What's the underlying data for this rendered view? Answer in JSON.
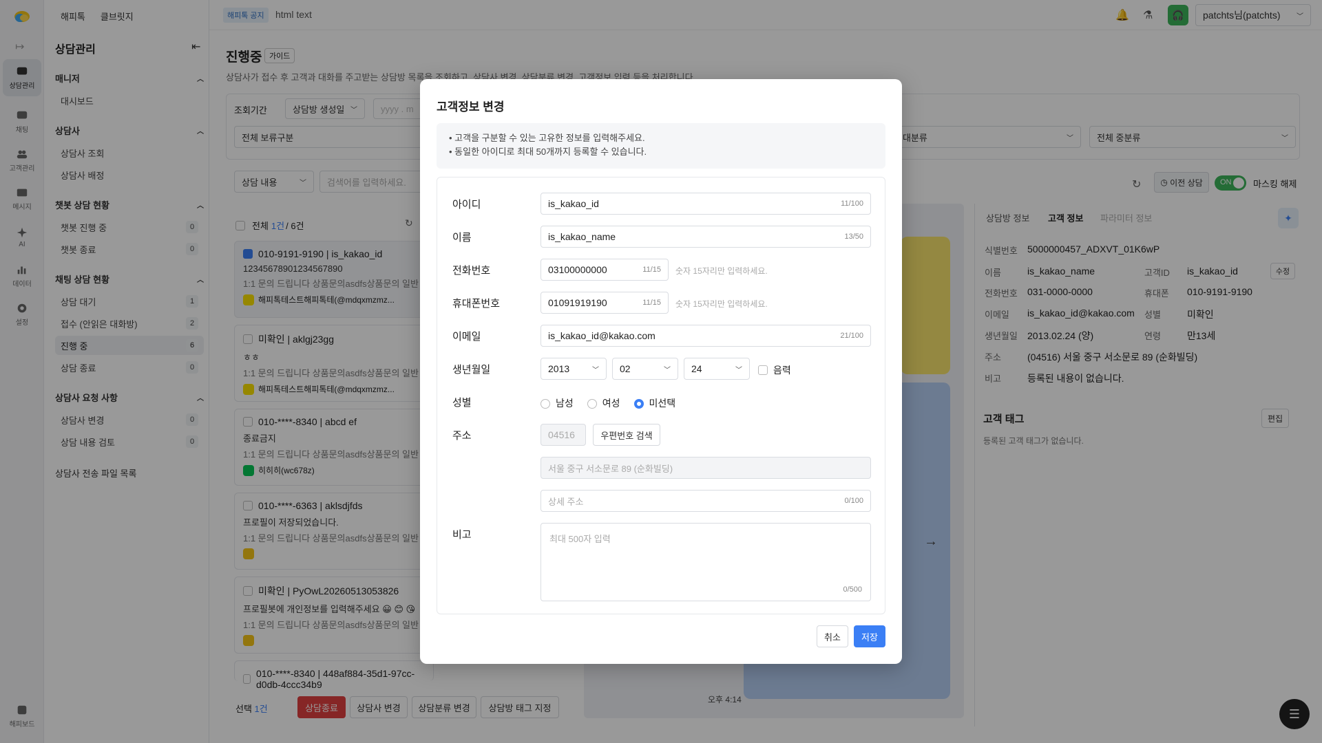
{
  "rail": [
    {
      "label": "상담관리",
      "icon": "chat-bubble-icon"
    },
    {
      "label": "채팅",
      "icon": "message-icon"
    },
    {
      "label": "고객관리",
      "icon": "users-icon"
    },
    {
      "label": "메시지",
      "icon": "mail-icon"
    },
    {
      "label": "AI",
      "icon": "sparkle-icon"
    },
    {
      "label": "데이터",
      "icon": "bar-chart-icon"
    },
    {
      "label": "설정",
      "icon": "gear-icon"
    },
    {
      "label": "해피보드",
      "icon": "puzzle-icon"
    }
  ],
  "sidebar": {
    "top_links": [
      "해피톡",
      "클브릿지"
    ],
    "title": "상담관리",
    "sections": [
      {
        "title": "매니저",
        "items": [
          {
            "label": "대시보드"
          }
        ]
      },
      {
        "title": "상담사",
        "items": [
          {
            "label": "상담사 조회"
          },
          {
            "label": "상담사 배정"
          }
        ]
      },
      {
        "title": "챗봇 상담 현황",
        "items": [
          {
            "label": "챗봇 진행 중",
            "count": "0"
          },
          {
            "label": "챗봇 종료",
            "count": "0"
          }
        ]
      },
      {
        "title": "채팅 상담 현황",
        "items": [
          {
            "label": "상담 대기",
            "count": "1"
          },
          {
            "label": "접수 (안읽은 대화방)",
            "count": "2"
          },
          {
            "label": "진행 중",
            "count": "6"
          },
          {
            "label": "상담 종료",
            "count": "0"
          }
        ]
      },
      {
        "title": "상담사 요청 사항",
        "items": [
          {
            "label": "상담사 변경",
            "count": "0"
          },
          {
            "label": "상담 내용 검토",
            "count": "0"
          }
        ]
      }
    ],
    "extra": "상담사 전송 파일 목록"
  },
  "topbar": {
    "badge": "해피톡 공지",
    "notice": "html text",
    "user": "patchts님(patchts)"
  },
  "page": {
    "title": "진행중",
    "guide": "가이드",
    "desc": "상담사가 접수 후 고객과 대화를 주고받는 상담방 목록을 조회하고, 상담사 변경, 상담분류 변경, 고객정보 입력 등을 처리합니다."
  },
  "filters": {
    "period_label": "조회기간",
    "period_select": "상담방 생성일",
    "date_placeholder": "yyyy . m",
    "hold": "전체 보류구분",
    "big_cat": "대분류",
    "mid_cat": "전체 중분류",
    "search_type": "상담 내용",
    "search_placeholder": "검색어를 입력하세요."
  },
  "list": {
    "all_label": "전체",
    "sel_count": "1건",
    "total": "/ 6건",
    "cards": [
      {
        "title": "010-9191-9190 | is_kakao_id",
        "line": "12345678901234567890",
        "gray": "1:1 문의 드립니다 상품문의asdfs상품문의 일반",
        "channel": "해피톡테스트해피톡테(@mdqxmzmz...",
        "ch": "kakao",
        "checked": true
      },
      {
        "title": "미확인 | aklgj23gg",
        "line": "ㅎㅎ",
        "gray": "1:1 문의 드립니다 상품문의asdfs상품문의 일반",
        "channel": "해피톡테스트해피톡테(@mdqxmzmz...",
        "ch": "kakao",
        "checked": false
      },
      {
        "title": "010-****-8340 | abcd ef",
        "line": "종료금지",
        "gray": "1:1 문의 드립니다 상품문의asdfs상품문의 일반",
        "channel": "히히히(wc678z)",
        "ch": "line",
        "checked": false
      },
      {
        "title": "010-****-6363 | aklsdjfds",
        "line": "프로필이 저장되었습니다.",
        "gray": "1:1 문의 드립니다 상품문의asdfs상품문의 일반",
        "channel": "",
        "ch": "other",
        "checked": false
      },
      {
        "title": "미확인 | PyOwL20260513053826",
        "line": "프로필봇에 개인정보를 입력해주세요 😀 😊 😘",
        "gray": "1:1 문의 드립니다 상품문의asdfs상품문의 일반",
        "channel": "",
        "ch": "other",
        "checked": false
      },
      {
        "title": "010-****-8340 | 448af884-35d1-97cc-d0db-4ccc34b9",
        "line": "",
        "gray": "",
        "channel": "",
        "ch": "",
        "checked": false
      }
    ]
  },
  "bottom": {
    "sel_label": "선택",
    "sel_count": "1건",
    "end": "상담종료",
    "change_agent": "상담사 변경",
    "change_cat": "상담분류 변경",
    "tag": "상담방 태그 지정"
  },
  "chat": {
    "time": "오후 4:14"
  },
  "right": {
    "prev": "이전 상담",
    "toggle": "ON",
    "mask": "마스킹 해제",
    "tabs": [
      "상담방 정보",
      "고객 정보",
      "파라미터 정보"
    ],
    "id_label": "식별번호",
    "id_value": "5000000457_ADXVT_01K6wP",
    "rows": [
      {
        "l1": "이름",
        "v1": "is_kakao_name",
        "l2": "고객ID",
        "v2": "is_kakao_id"
      },
      {
        "l1": "전화번호",
        "v1": "031-0000-0000",
        "l2": "휴대폰",
        "v2": "010-9191-9190"
      },
      {
        "l1": "이메일",
        "v1": "is_kakao_id@kakao.com",
        "l2": "성별",
        "v2": "미확인"
      },
      {
        "l1": "생년월일",
        "v1": "2013.02.24 (양)",
        "l2": "연령",
        "v2": "만13세"
      }
    ],
    "edit": "수정",
    "addr_label": "주소",
    "addr_value": "(04516) 서울 중구 서소문로 89 (순화빌딩)",
    "memo_label": "비고",
    "memo_value": "등록된 내용이 없습니다.",
    "tag_title": "고객 태그",
    "tag_edit": "편집",
    "tag_empty": "등록된 고객 태그가 없습니다."
  },
  "modal": {
    "title": "고객정보 변경",
    "notes": [
      "• 고객을 구분할 수 있는 고유한 정보를 입력해주세요.",
      "• 동일한 아이디로 최대 50개까지 등록할 수 있습니다."
    ],
    "id": {
      "label": "아이디",
      "value": "is_kakao_id",
      "count": "11/100"
    },
    "name": {
      "label": "이름",
      "value": "is_kakao_name",
      "count": "13/50"
    },
    "phone": {
      "label": "전화번호",
      "value": "03100000000",
      "count": "11/15",
      "hint": "숫자 15자리만 입력하세요."
    },
    "mobile": {
      "label": "휴대폰번호",
      "value": "01091919190",
      "count": "11/15",
      "hint": "숫자 15자리만 입력하세요."
    },
    "email": {
      "label": "이메일",
      "value": "is_kakao_id@kakao.com",
      "count": "21/100"
    },
    "birth": {
      "label": "생년월일",
      "year": "2013",
      "month": "02",
      "day": "24",
      "lunar": "음력"
    },
    "gender": {
      "label": "성별",
      "male": "남성",
      "female": "여성",
      "none": "미선택",
      "selected": "none"
    },
    "addr": {
      "label": "주소",
      "zip": "04516",
      "search": "우편번호 검색",
      "road": "서울 중구 서소문로 89 (순화빌딩)",
      "detail_placeholder": "상세 주소",
      "detail_count": "0/100"
    },
    "memo": {
      "label": "비고",
      "placeholder": "최대 500자 입력",
      "count": "0/500"
    },
    "cancel": "취소",
    "save": "저장"
  }
}
